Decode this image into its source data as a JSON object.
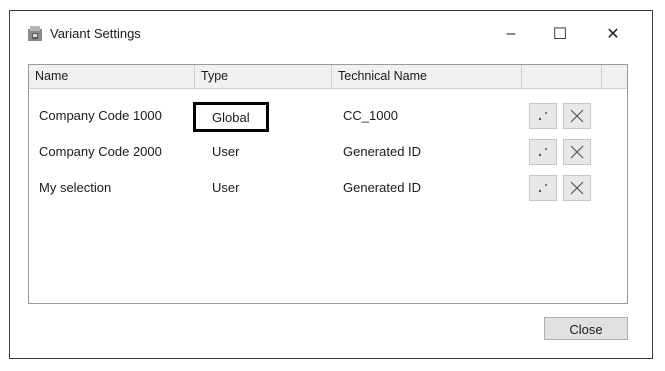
{
  "window": {
    "title": "Variant Settings",
    "controls": {
      "minimize": "–",
      "maximize": "☐",
      "close": "✕"
    },
    "app_icon": "variant-settings-icon"
  },
  "table": {
    "columns": [
      "Name",
      "Type",
      "Technical Name",
      ""
    ],
    "rows": [
      {
        "name": "Company Code 1000",
        "type": "Global",
        "technical_name": "CC_1000",
        "highlighted": true
      },
      {
        "name": "Company Code 2000",
        "type": "User",
        "technical_name": "Generated ID",
        "highlighted": false
      },
      {
        "name": "My selection",
        "type": "User",
        "technical_name": "Generated ID",
        "highlighted": false
      }
    ],
    "row_actions": [
      "edit-icon",
      "delete-icon"
    ]
  },
  "footer": {
    "close_label": "Close"
  },
  "colors": {
    "highlight_border": "#000000",
    "header_bg": "#f0f0f0",
    "button_bg": "#e1e1e1"
  }
}
